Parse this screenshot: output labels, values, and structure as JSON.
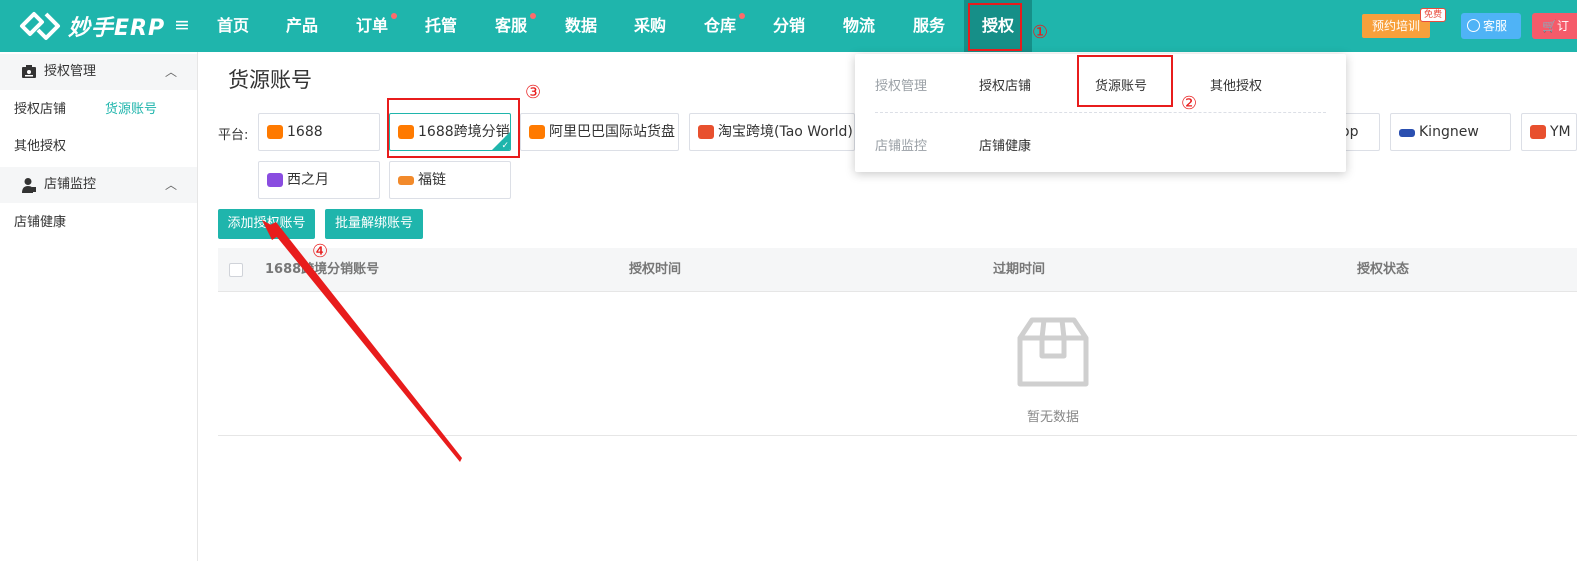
{
  "header": {
    "logo_text": "妙手ERP",
    "nav": [
      "首页",
      "产品",
      "订单",
      "托管",
      "客服",
      "数据",
      "采购",
      "仓库",
      "分销",
      "物流",
      "服务",
      "授权"
    ],
    "training_label": "预约培训",
    "free_badge": "免费",
    "service_label": "客服",
    "cart_label": "订"
  },
  "sidebar": {
    "group1": "授权管理",
    "group1_items": [
      "授权店铺",
      "货源账号",
      "其他授权"
    ],
    "group2": "店铺监控",
    "group2_items": [
      "店铺健康"
    ]
  },
  "main": {
    "title": "货源账号",
    "platform_label": "平台:",
    "platforms": [
      "1688",
      "1688跨境分销",
      "阿里巴巴国际站货盘",
      "淘宝跨境(Tao World)",
      "op",
      "Kingnew",
      "YM",
      "西之月",
      "福链"
    ],
    "add_button": "添加授权账号",
    "batch_button": "批量解绑账号",
    "columns": [
      "1688跨境分销账号",
      "授权时间",
      "过期时间",
      "授权状态"
    ],
    "empty_text": "暂无数据"
  },
  "dropdown": {
    "section1": "授权管理",
    "section1_links": [
      "授权店铺",
      "货源账号",
      "其他授权"
    ],
    "section2": "店铺监控",
    "section2_links": [
      "店铺健康"
    ]
  },
  "annotations": [
    "①",
    "②",
    "③",
    "④"
  ],
  "colors": {
    "brand": "#1fb5ac",
    "annotation": "#e81c1c",
    "training": "#f7a03c",
    "service": "#4fb3f6",
    "cart": "#f55b6a"
  }
}
